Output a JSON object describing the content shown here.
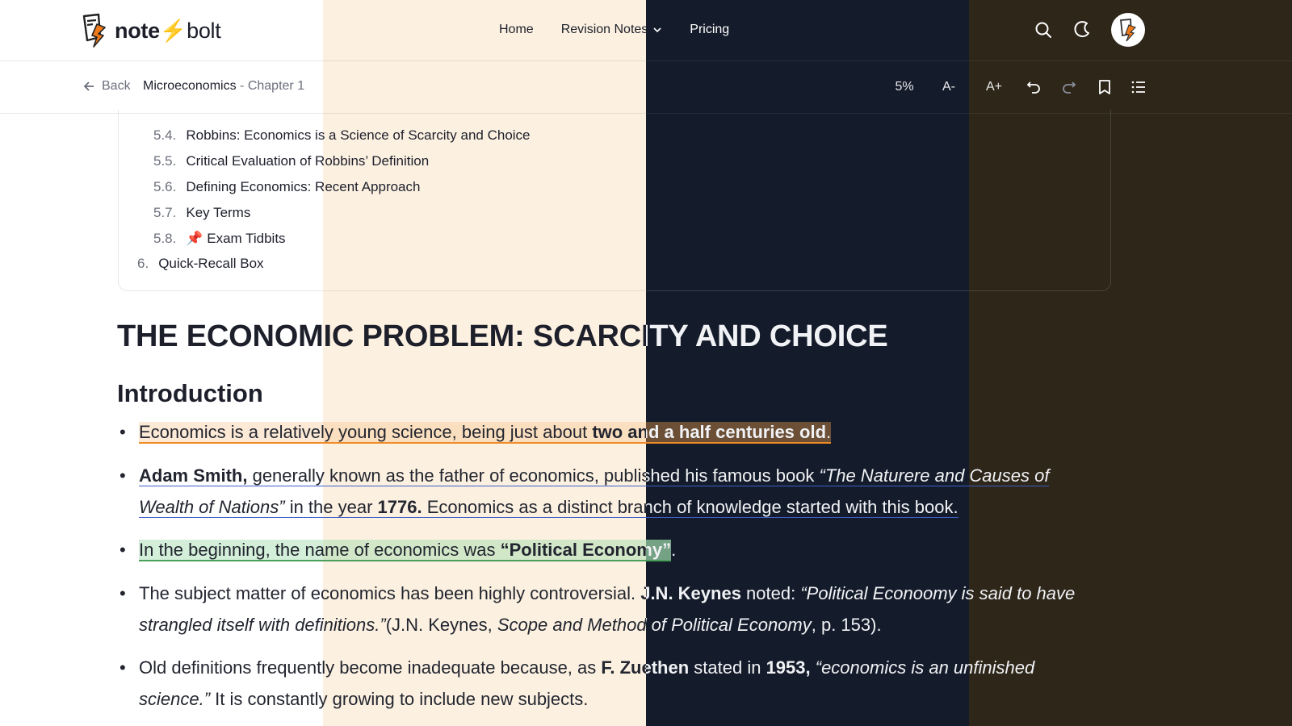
{
  "header": {
    "logo_note": "note",
    "logo_bolt": "bolt",
    "nav": {
      "home": "Home",
      "revision_notes": "Revision Notes",
      "pricing": "Pricing"
    }
  },
  "subbar": {
    "back_label": "Back",
    "crumb_subject": "Microeconomics",
    "crumb_chapter": "- Chapter 1",
    "progress": "5%",
    "font_decrease": "A-",
    "font_increase": "A+"
  },
  "toc": {
    "items": [
      {
        "num": "5.4.",
        "label": "Robbins: Economics is a Science of Scarcity and Choice"
      },
      {
        "num": "5.5.",
        "label": "Critical Evaluation of Robbins’ Definition"
      },
      {
        "num": "5.6.",
        "label": "Defining Economics: Recent Approach"
      },
      {
        "num": "5.7.",
        "label": "Key Terms"
      },
      {
        "num": "5.8.",
        "label": "📌 Exam Tidbits"
      },
      {
        "num": "6.",
        "label": "Quick-Recall Box"
      }
    ]
  },
  "content": {
    "title": "THE ECONOMIC PROBLEM: SCARCITY AND CHOICE",
    "section": "Introduction",
    "b1": {
      "a": "Economics is a relatively young science, being just about ",
      "bold": "two and a half centuries old",
      "end": "."
    },
    "b2": {
      "bold1": "Adam Smith,",
      "a": " generally known as the father of economics, published his famous book ",
      "italic": "“The Naturere and Causes of Wealth of Nations”",
      "b": " in the year ",
      "bold2": "1776.",
      "c": " Economics as a distinct branch of knowledge started with this book."
    },
    "b3": {
      "a": "In the beginning, the name of economics was ",
      "bold": "“Political Economy”",
      "end": "."
    },
    "b4": {
      "a": "The subject matter of economics has been highly controversial. ",
      "bold": "J.N. Keynes",
      "b": " noted: ",
      "italic1": "“Political Econoomy is said to have strangled itself with definitions.”",
      "c": "(J.N. Keynes, ",
      "italic2": "Scope and Method of Political Economy",
      "d": ", p. 153)."
    },
    "b5": {
      "a": "Old definitions frequently become inadequate because, as ",
      "bold1": "F. Zuethen",
      "b": " stated in ",
      "bold2": "1953,",
      "italic": " “economics is an unfinished science.”",
      "c": " It is constantly growing to include new subjects."
    }
  },
  "colors": {
    "accent_orange": "#f07a1a",
    "band_cream": "#fcf1e1",
    "band_dark": "#141c2b",
    "band_brown": "#2e2618"
  }
}
